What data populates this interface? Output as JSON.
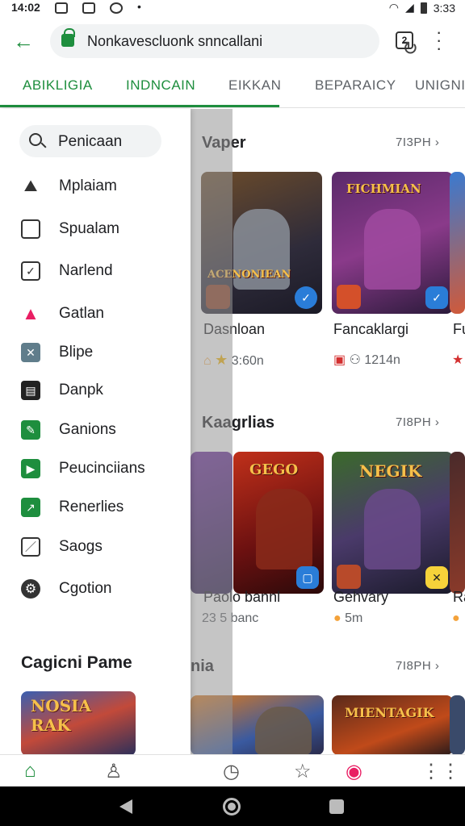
{
  "status": {
    "time": "14:02",
    "battery_time": "3:33"
  },
  "browser": {
    "url": "Nonkavescluonk snncallani"
  },
  "tabs": [
    "ABIKLIGIA",
    "INDNCAIN",
    "EIKKAN",
    "BEPARAICY",
    "UNIGNIA"
  ],
  "drawer": {
    "search_label": "Penicaan",
    "items": [
      {
        "label": "Mplaiam",
        "icon": "mountain-icon",
        "color": "#333"
      },
      {
        "label": "Spualam",
        "icon": "window-icon",
        "color": "#333"
      },
      {
        "label": "Narlend",
        "icon": "calendar-icon",
        "color": "#333"
      },
      {
        "label": "Gatlan",
        "icon": "arrow-up-icon",
        "color": "#e91e63"
      },
      {
        "label": "Blipe",
        "icon": "puzzle-icon",
        "color": "#607d8b"
      },
      {
        "label": "Danpk",
        "icon": "film-icon",
        "color": "#222"
      },
      {
        "label": "Ganions",
        "icon": "edit-icon",
        "color": "#1e8e3e"
      },
      {
        "label": "Peucinciians",
        "icon": "play-icon",
        "color": "#1e8e3e"
      },
      {
        "label": "Renerlies",
        "icon": "trend-icon",
        "color": "#1e8e3e"
      },
      {
        "label": "Saogs",
        "icon": "pencil-icon",
        "color": "#333"
      },
      {
        "label": "Cgotion",
        "icon": "gear-icon",
        "color": "#333"
      }
    ],
    "section_title": "Cagicni Pame",
    "thumb_title": "NOSIA RAK"
  },
  "sections": [
    {
      "title": "Vaper",
      "more": "7I3PH",
      "cards": [
        {
          "title": "ACENONIEAN",
          "name": "Dasnloan",
          "meta": "3:60n",
          "badge": "bolt-icon"
        },
        {
          "title": "FICHMIAN",
          "name": "Fancaklargi",
          "meta": "1214n",
          "badge": "check-icon"
        },
        {
          "title": "",
          "name": "Fu",
          "meta": "",
          "badge": ""
        }
      ]
    },
    {
      "title": "Kaagrlias",
      "more": "7I8PH",
      "cards": [
        {
          "title": "GEGO",
          "name": "Paolo bannl",
          "meta": "23 5 banc",
          "badge": "square-icon"
        },
        {
          "title": "NEGIK",
          "name": "Gehvary",
          "meta": "5m",
          "badge": "x-icon"
        },
        {
          "title": "",
          "name": "Ra",
          "meta": "",
          "badge": ""
        }
      ]
    },
    {
      "title": "nia",
      "more": "7I8PH",
      "cards": [
        {
          "title": "",
          "name": "",
          "meta": "",
          "badge": ""
        },
        {
          "title": "MIENTAGIK",
          "name": "",
          "meta": "",
          "badge": ""
        }
      ]
    }
  ],
  "bottom_nav": [
    "home-icon",
    "user-icon",
    "timer-icon",
    "rank-icon",
    "shield-icon",
    "grid-icon"
  ]
}
